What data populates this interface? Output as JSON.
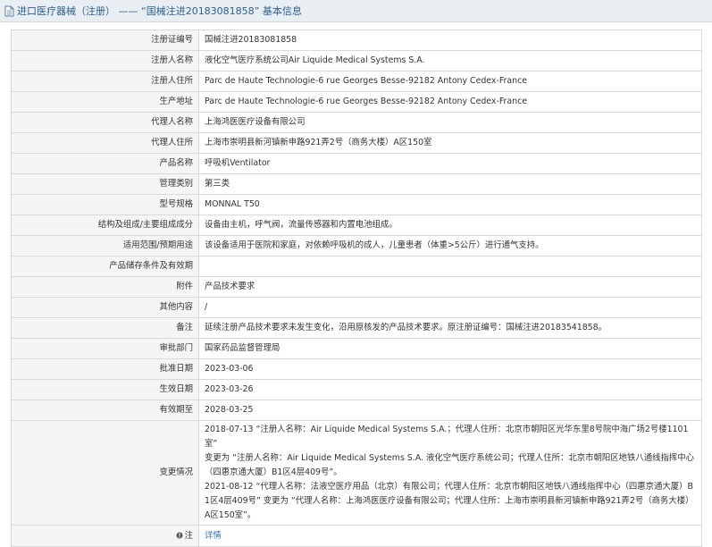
{
  "header": {
    "title": "进口医疗器械（注册） —— “国械注进20183081858” 基本信息",
    "icon": "document-icon"
  },
  "rows": [
    {
      "label": "注册证编号",
      "value": "国械注进20183081858"
    },
    {
      "label": "注册人名称",
      "value": "液化空气医疗系统公司Air Liquide Medical Systems S.A."
    },
    {
      "label": "注册人住所",
      "value": "Parc de Haute Technologie-6 rue Georges Besse-92182 Antony Cedex-France"
    },
    {
      "label": "生产地址",
      "value": "Parc de Haute Technologie-6 rue Georges Besse-92182 Antony Cedex-France"
    },
    {
      "label": "代理人名称",
      "value": "上海鸿医医疗设备有限公司"
    },
    {
      "label": "代理人住所",
      "value": "上海市崇明县新河镇新申路921弄2号（商务大楼）A区150室"
    },
    {
      "label": "产品名称",
      "value": "呼吸机Ventilator"
    },
    {
      "label": "管理类别",
      "value": "第三类"
    },
    {
      "label": "型号规格",
      "value": "MONNAL T50"
    },
    {
      "label": "结构及组成/主要组成成分",
      "value": "设备由主机，呼气阀，流量传感器和内置电池组成。"
    },
    {
      "label": "适用范围/预期用途",
      "value": "该设备适用于医院和家庭，对依赖呼吸机的成人，儿童患者（体重>5公斤）进行通气支持。"
    },
    {
      "label": "产品储存条件及有效期",
      "value": ""
    },
    {
      "label": "附件",
      "value": "产品技术要求"
    },
    {
      "label": "其他内容",
      "value": "/"
    },
    {
      "label": "备注",
      "value": "延续注册产品技术要求未发生变化，沿用原核发的产品技术要求。原注册证编号：国械注进20183541858。"
    },
    {
      "label": "审批部门",
      "value": "国家药品监督管理局"
    },
    {
      "label": "批准日期",
      "value": "2023-03-06"
    },
    {
      "label": "生效日期",
      "value": "2023-03-26"
    },
    {
      "label": "有效期至",
      "value": "2028-03-25"
    }
  ],
  "change": {
    "label": "变更情况",
    "lines": [
      "2018-07-13 “注册人名称：Air Liquide Medical Systems S.A.；代理人住所：北京市朝阳区光华东里8号院中海广场2号楼1101室”",
      "变更为 “注册人名称：Air Liquide Medical Systems S.A. 液化空气医疗系统公司；代理人住所：北京市朝阳区地铁八通线指挥中心",
      "（四惠京通大厦）B1区4层409号”。",
      "2021-08-12 “代理人名称：法液空医疗用品（北京）有限公司；代理人住所：北京市朝阳区地铁八通线指挥中心（四惠京通大厦）B",
      "1区4层409号” 变更为 “代理人名称：上海鸿医医疗设备有限公司；代理人住所：上海市崇明县新河镇新申路921弄2号（商务大楼）",
      "A区150室”。"
    ]
  },
  "note": {
    "label": "注",
    "icon": "note-icon",
    "link_text": "详情",
    "link_color": "#2a6ebb"
  }
}
